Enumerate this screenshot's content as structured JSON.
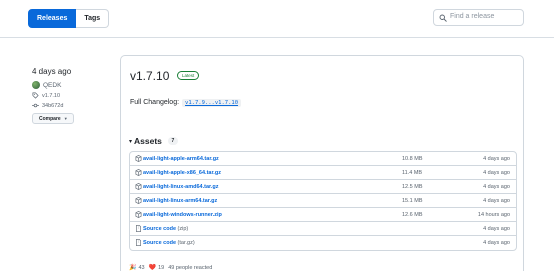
{
  "header": {
    "tabs": [
      {
        "label": "Releases",
        "active": true
      },
      {
        "label": "Tags",
        "active": false
      }
    ],
    "search": {
      "placeholder": "Find a release"
    }
  },
  "sidebar": {
    "date": "4 days ago",
    "author": "QEDK",
    "tag": "v1.7.10",
    "commit": "34b672d",
    "compare_label": "Compare"
  },
  "release": {
    "version": "v1.7.10",
    "badge": "Latest",
    "changelog_label": "Full Changelog:",
    "changelog_link": "v1.7.9...v1.7.10",
    "assets_title": "Assets",
    "assets_count": "7",
    "assets": [
      {
        "name": "avail-light-apple-arm64.tar.gz",
        "suffix": "",
        "size": "10.8 MB",
        "time": "4 days ago",
        "icon": "package-icon"
      },
      {
        "name": "avail-light-apple-x86_64.tar.gz",
        "suffix": "",
        "size": "11.4 MB",
        "time": "4 days ago",
        "icon": "package-icon"
      },
      {
        "name": "avail-light-linux-amd64.tar.gz",
        "suffix": "",
        "size": "12.5 MB",
        "time": "4 days ago",
        "icon": "package-icon"
      },
      {
        "name": "avail-light-linux-arm64.tar.gz",
        "suffix": "",
        "size": "15.1 MB",
        "time": "4 days ago",
        "icon": "package-icon"
      },
      {
        "name": "avail-light-windows-runner.zip",
        "suffix": "",
        "size": "12.6 MB",
        "time": "14 hours ago",
        "icon": "package-icon"
      },
      {
        "name": "Source code",
        "suffix": "(zip)",
        "size": "",
        "time": "4 days ago",
        "icon": "file-zip-icon"
      },
      {
        "name": "Source code",
        "suffix": "(tar.gz)",
        "size": "",
        "time": "4 days ago",
        "icon": "file-zip-icon"
      }
    ],
    "reactions": [
      {
        "emoji": "🎉",
        "count": "43"
      },
      {
        "emoji": "❤️",
        "count": "19"
      }
    ],
    "reacted_text": "49 people reacted"
  }
}
